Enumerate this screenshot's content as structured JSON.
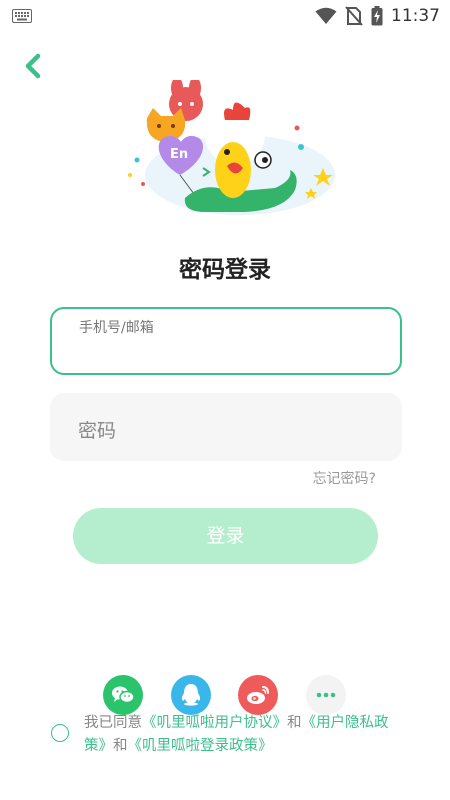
{
  "status_bar": {
    "time": "11:37"
  },
  "page": {
    "title": "密码登录"
  },
  "form": {
    "phone_label": "手机号/邮箱",
    "password_placeholder": "密码",
    "forgot_label": "忘记密码?",
    "login_label": "登录"
  },
  "social": {
    "more_label": "•••"
  },
  "agreement": {
    "prefix": "我已同意",
    "user_agreement": "《叽里呱啦用户协议》",
    "and1": "和",
    "privacy_policy": "《用户隐私政策》",
    "and2": "和",
    "login_policy": "《叽里呱啦登录政策》"
  },
  "colors": {
    "accent": "#3bbf8c",
    "button_disabled": "#b4eece"
  }
}
